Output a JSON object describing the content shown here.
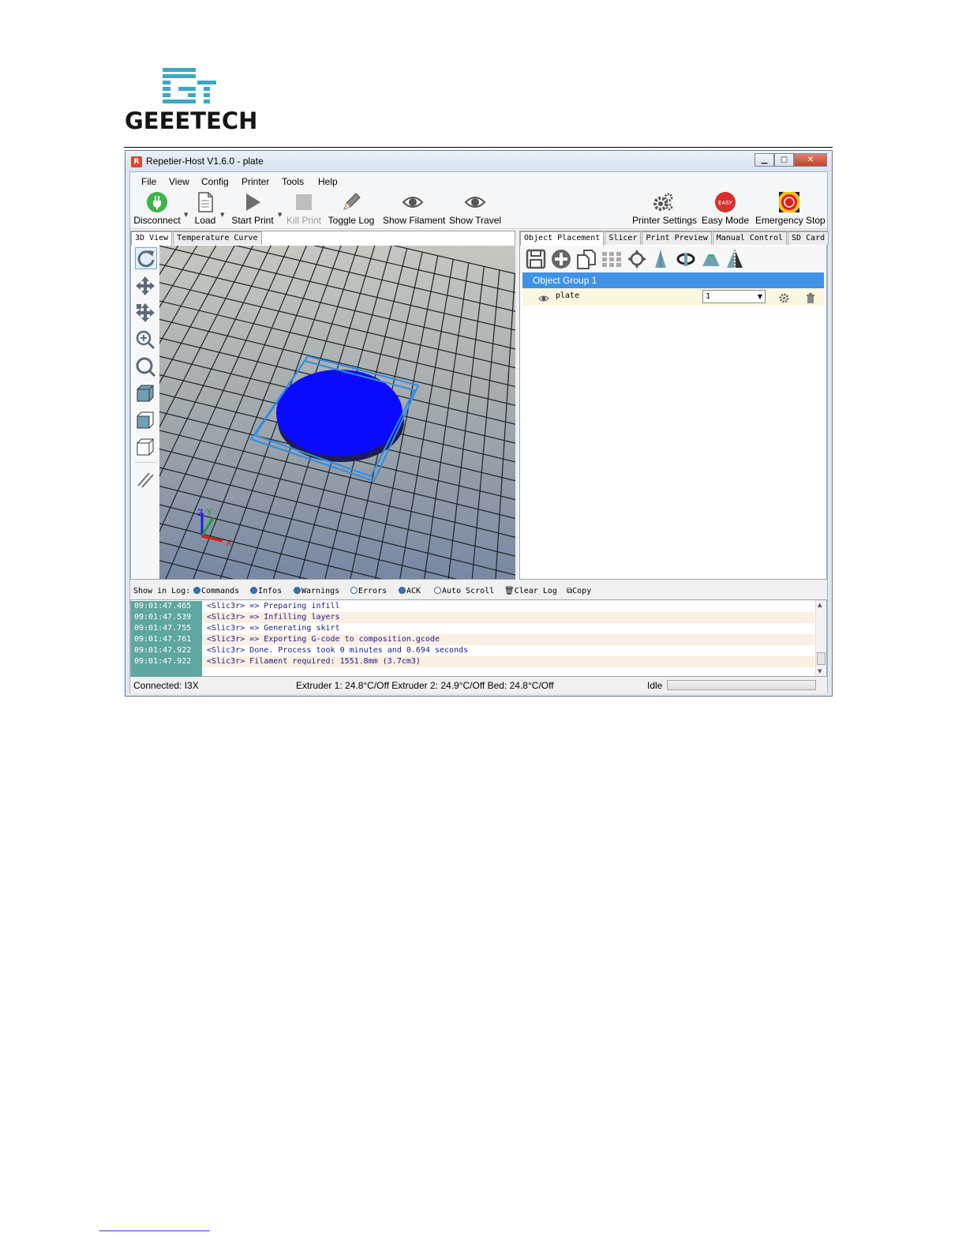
{
  "document": {
    "logo_text": "GEEETECH",
    "brand_color": "#3aa9c4"
  },
  "window": {
    "title": "Repetier-Host V1.6.0 - plate",
    "app_icon": "R",
    "controls": [
      "minimize",
      "maximize",
      "close"
    ]
  },
  "menu": [
    "File",
    "View",
    "Config",
    "Printer",
    "Tools",
    "Help"
  ],
  "toolbar": {
    "disconnect": "Disconnect",
    "load": "Load",
    "start_print": "Start Print",
    "kill_print": "Kill Print",
    "toggle_log": "Toggle Log",
    "show_filament": "Show Filament",
    "show_travel": "Show Travel",
    "printer_settings": "Printer Settings",
    "easy_mode": "Easy Mode",
    "easy_badge": "EASY",
    "emergency_stop": "Emergency Stop"
  },
  "left_tabs": [
    "3D View",
    "Temperature Curve"
  ],
  "view_tools": [
    "rotate-icon",
    "move-icon",
    "move-object-icon",
    "zoom-icon",
    "fit-view-icon",
    "iso-view-icon",
    "front-view-icon",
    "top-view-icon",
    "parallel-icon"
  ],
  "axes": {
    "z": "Z",
    "y": "Y",
    "x": "X"
  },
  "right_tabs": [
    "Object Placement",
    "Slicer",
    "Print Preview",
    "Manual Control",
    "SD Card"
  ],
  "object_tools": [
    "save-icon",
    "add-icon",
    "copy-icon",
    "autoplace-icon",
    "center-icon",
    "scale-icon",
    "rotate-icon",
    "land-icon",
    "mirror-icon"
  ],
  "object_group": "Object Group 1",
  "object": {
    "name": "plate",
    "copies": "1"
  },
  "log_bar": {
    "show_in_log": "Show in Log:",
    "commands": "Commands",
    "infos": "Infos",
    "warnings": "Warnings",
    "errors": "Errors",
    "ack": "ACK",
    "auto_scroll": "Auto Scroll",
    "clear_log": "Clear Log",
    "copy": "Copy"
  },
  "log": [
    {
      "time": "09:01:47.465",
      "msg": "<Slic3r> => Preparing infill"
    },
    {
      "time": "09:01:47.539",
      "msg": "<Slic3r> => Infilling layers"
    },
    {
      "time": "09:01:47.755",
      "msg": "<Slic3r> => Generating skirt"
    },
    {
      "time": "09:01:47.761",
      "msg": "<Slic3r> => Exporting G-code to composition.gcode"
    },
    {
      "time": "09:01:47.922",
      "msg": "<Slic3r> Done. Process took 0 minutes and 0.694 seconds"
    },
    {
      "time": "09:01:47.922",
      "msg": "<Slic3r> Filament required: 1551.8mm (3.7cm3)"
    }
  ],
  "status": {
    "connected": "Connected: I3X",
    "temps": "Extruder 1: 24.8°C/Off Extruder 2: 24.9°C/Off Bed: 24.8°C/Off",
    "state": "Idle",
    "progress": 0
  },
  "colors": {
    "object": "#0a0aff",
    "selection_box": "#2f8de8",
    "group_highlight": "#3f92e6",
    "timestamp_bg": "#5ea6a0"
  }
}
